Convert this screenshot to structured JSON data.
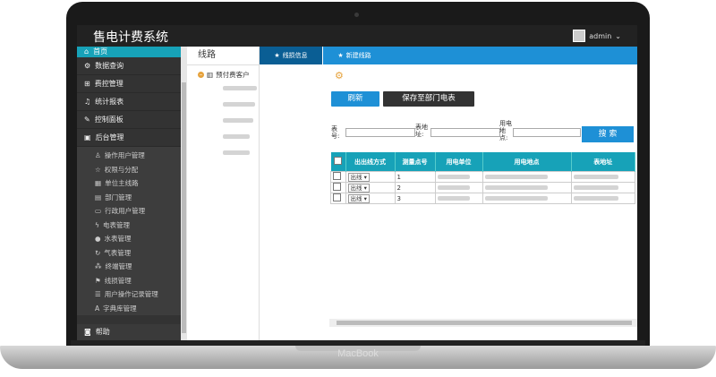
{
  "app": {
    "title": "售电计费系统",
    "user": "admin",
    "brand": "MacBook"
  },
  "sidebar": {
    "home": "首页",
    "items": [
      {
        "icon": "gears-icon",
        "label": "数据查询"
      },
      {
        "icon": "sitemap-icon",
        "label": "费控管理"
      },
      {
        "icon": "bell-icon",
        "label": "统计报表"
      },
      {
        "icon": "pencil-icon",
        "label": "控制面板"
      },
      {
        "icon": "briefcase-icon",
        "label": "后台管理"
      }
    ],
    "subitems": [
      {
        "icon": "users-icon",
        "label": "操作用户管理"
      },
      {
        "icon": "star-icon",
        "label": "权限与分配"
      },
      {
        "icon": "grid-icon",
        "label": "单位主线路"
      },
      {
        "icon": "table-icon",
        "label": "部门管理"
      },
      {
        "icon": "id-card-icon",
        "label": "行政用户管理"
      },
      {
        "icon": "bolt-icon",
        "label": "电表管理"
      },
      {
        "icon": "drop-icon",
        "label": "水表管理"
      },
      {
        "icon": "refresh-icon",
        "label": "气表管理"
      },
      {
        "icon": "terminal-icon",
        "label": "终端管理"
      },
      {
        "icon": "flag-icon",
        "label": "线损管理"
      },
      {
        "icon": "list-icon",
        "label": "用户操作记录管理"
      },
      {
        "icon": "font-icon",
        "label": "字典库管理"
      }
    ],
    "help": "帮助"
  },
  "tree": {
    "header": "线路",
    "root": "预付费客户"
  },
  "tabs": [
    {
      "label": "线损信息"
    },
    {
      "label": "新建线路"
    }
  ],
  "toolbar": {
    "refresh": "刷新",
    "save": "保存至部门电表"
  },
  "search": {
    "meter_no_label": "表号:",
    "meter_addr_label": "表地址:",
    "usage_point_label": "用电地点:",
    "button": "搜 索"
  },
  "table": {
    "headers": [
      "出出线方式",
      "测量点号",
      "用电单位",
      "用电地点",
      "表地址"
    ],
    "rows": [
      {
        "mode": "出线",
        "point": "1"
      },
      {
        "mode": "出线",
        "point": "2"
      },
      {
        "mode": "出线",
        "point": "3"
      }
    ]
  }
}
